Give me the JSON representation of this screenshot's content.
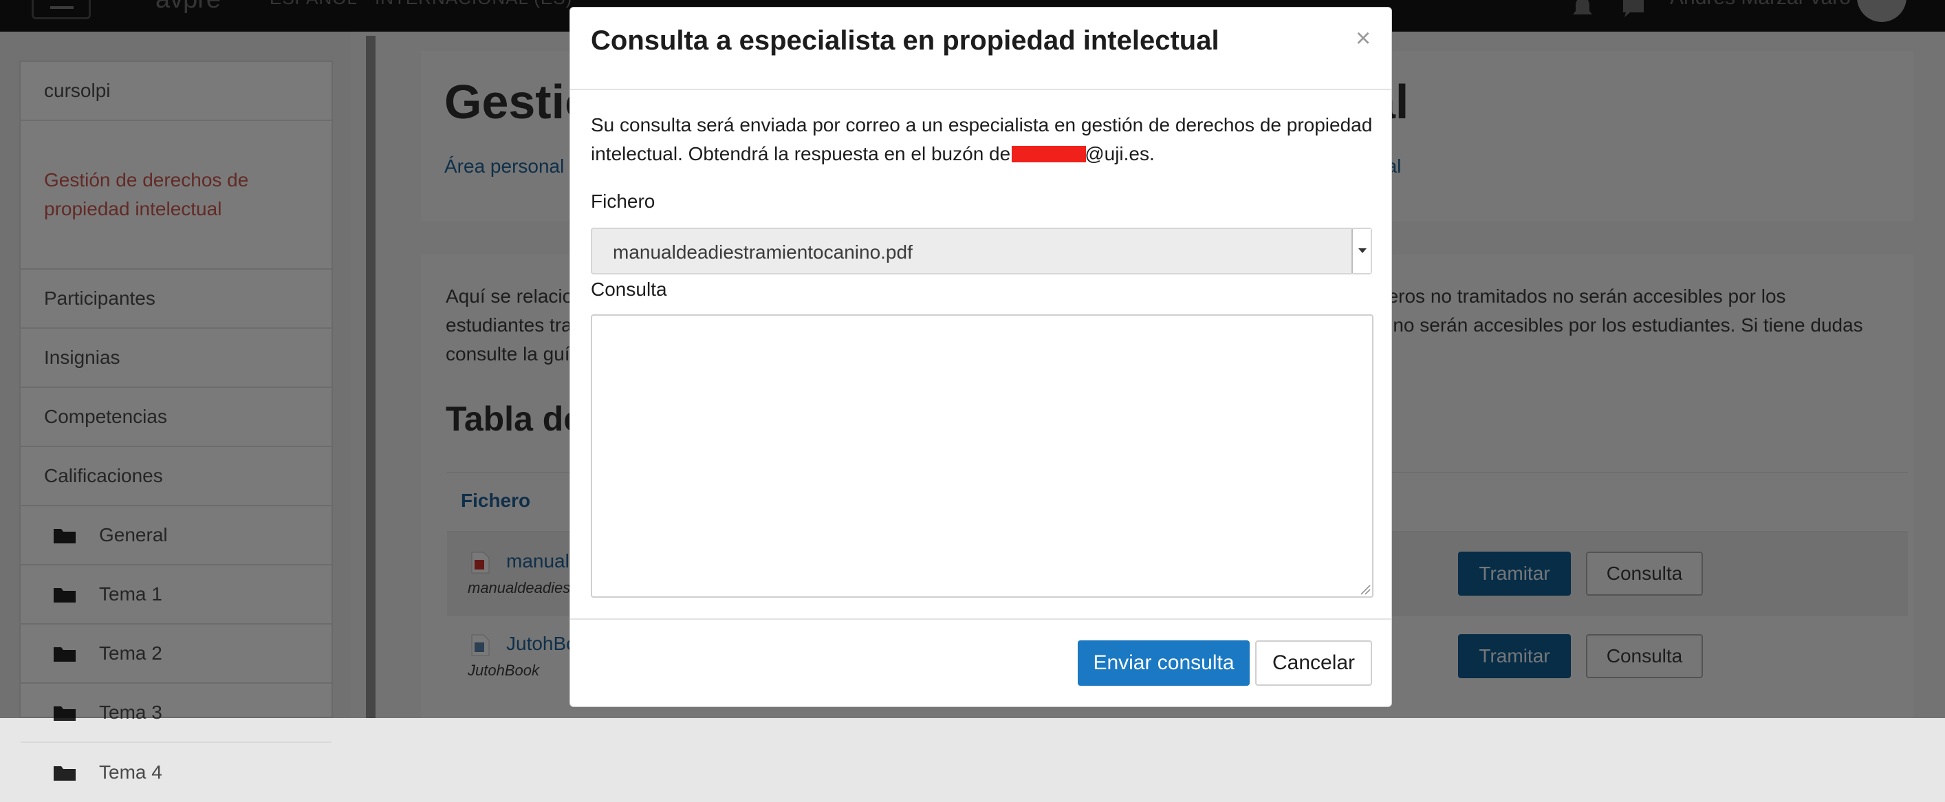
{
  "navbar": {
    "brand": "avpre",
    "language": "ESPAÑOL - INTERNACIONAL (ES)",
    "user_name": "Andrés Marzal Varó"
  },
  "sidebar": {
    "items": [
      {
        "label": "cursolpi"
      },
      {
        "label": "Gestión de derechos de propiedad intelectual",
        "active": true
      },
      {
        "label": "Participantes"
      },
      {
        "label": "Insignias"
      },
      {
        "label": "Competencias"
      },
      {
        "label": "Calificaciones"
      },
      {
        "label": "General",
        "icon": "folder-icon"
      },
      {
        "label": "Tema 1",
        "icon": "folder-icon"
      },
      {
        "label": "Tema 2",
        "icon": "folder-icon"
      },
      {
        "label": "Tema 3",
        "icon": "folder-icon"
      },
      {
        "label": "Tema 4",
        "icon": "folder-icon"
      }
    ]
  },
  "main": {
    "title_start": "Gestió",
    "title_end": "al",
    "breadcrumb_left": "Área personal",
    "breadcrumb_right": "ual",
    "intro_left_lines": [
      "Aquí se relacio",
      "estudiantes tra",
      "consulte la guí"
    ],
    "intro_right_lines": [
      "heros no tramitados no serán accesibles por los",
      "a no serán accesibles por los estudiantes. Si tiene dudas",
      ""
    ],
    "table_title": "Tabla de",
    "table_header_file": "Fichero",
    "rows": [
      {
        "name": "manual",
        "sub": "manualdeadies",
        "tramitar": "Tramitar",
        "consulta": "Consulta"
      },
      {
        "name": "JutohBo",
        "sub": "JutohBook",
        "tramitar": "Tramitar",
        "consulta": "Consulta"
      }
    ]
  },
  "modal": {
    "title": "Consulta a especialista en propiedad intelectual",
    "close": "×",
    "message_line1": "Su consulta será enviada por correo a un especialista en gestión de derechos de propiedad",
    "message_line2_before": "intelectual. Obtendrá la respuesta en el buzón de",
    "message_line2_after": "@uji.es.",
    "file_label": "Fichero",
    "file_selected": "manualdeadiestramientocanino.pdf",
    "query_label": "Consulta",
    "query_value": "",
    "send_button": "Enviar consulta",
    "cancel_button": "Cancelar"
  },
  "colors": {
    "primary": "#1b79c3",
    "tramitar": "#0f5a8e",
    "active_sidebar": "#c5554c",
    "link": "#1e5f92",
    "redaction": "#f0201a"
  }
}
